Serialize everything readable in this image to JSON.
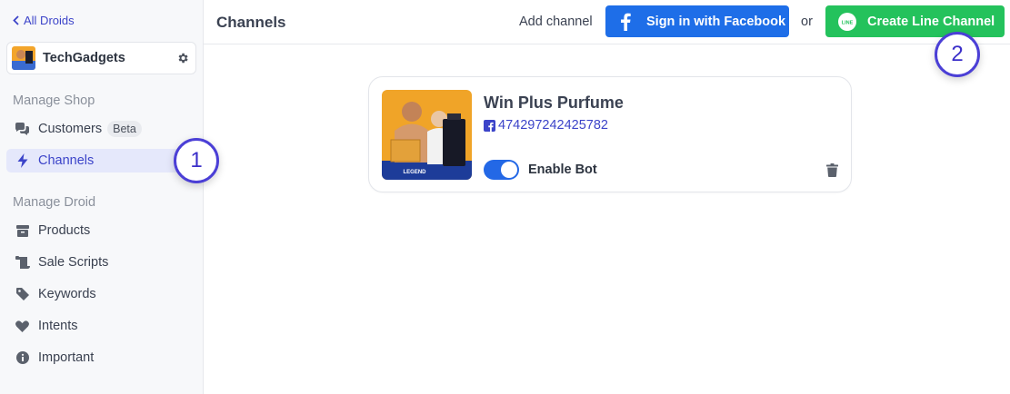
{
  "sidebar": {
    "back_label": "All Droids",
    "shop_name": "TechGadgets",
    "section_manage_shop": "Manage Shop",
    "section_manage_droid": "Manage Droid",
    "items": [
      {
        "label": "Customers",
        "badge": "Beta"
      },
      {
        "label": "Channels"
      },
      {
        "label": "Products"
      },
      {
        "label": "Sale Scripts"
      },
      {
        "label": "Keywords"
      },
      {
        "label": "Intents"
      },
      {
        "label": "Important"
      }
    ],
    "active_item": "Channels"
  },
  "header": {
    "title": "Channels",
    "add_channel_label": "Add channel",
    "facebook_button_label": "Sign in with Facebook",
    "or_label": "or",
    "line_button_label": "Create Line Channel",
    "line_logo_text": "LINE"
  },
  "channel": {
    "name": "Win Plus Purfume",
    "page_id": "474297242425782",
    "bot_label": "Enable Bot",
    "bot_enabled": true,
    "thumbnail_text": "LEGEND"
  },
  "annotations": [
    "1",
    "2"
  ],
  "colors": {
    "accent": "#3c44c9",
    "facebook_blue": "#1e6ee8",
    "line_green": "#24c25c",
    "toggle_on": "#2368e6"
  }
}
